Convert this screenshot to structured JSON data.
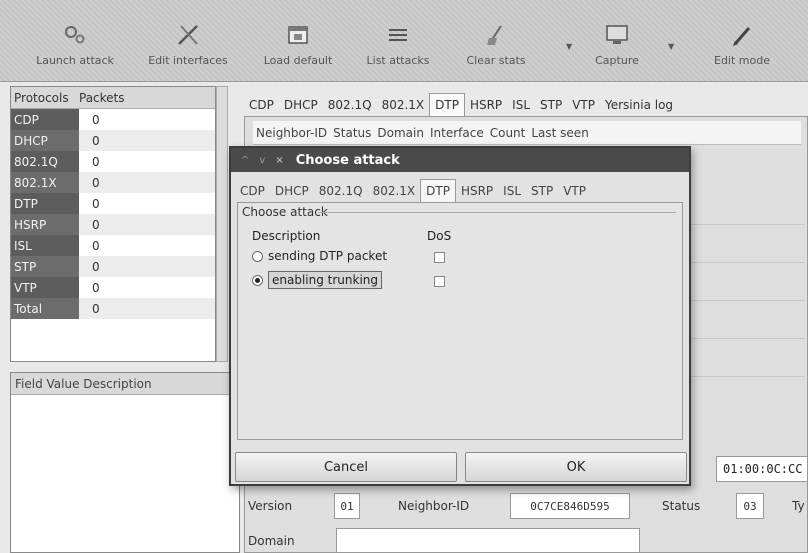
{
  "toolbar": {
    "buttons": [
      {
        "label": "Launch attack",
        "icon": "gears-icon"
      },
      {
        "label": "Edit interfaces",
        "icon": "tools-icon"
      },
      {
        "label": "Load default",
        "icon": "window-icon"
      },
      {
        "label": "List attacks",
        "icon": "list-icon"
      },
      {
        "label": "Clear stats",
        "icon": "broom-icon"
      },
      {
        "label": "Capture",
        "icon": "monitor-icon"
      },
      {
        "label": "Edit mode",
        "icon": "pen-icon"
      }
    ]
  },
  "protocols": {
    "header_protocols": "Protocols",
    "header_packets": "Packets",
    "rows": [
      {
        "name": "CDP",
        "count": "0"
      },
      {
        "name": "DHCP",
        "count": "0"
      },
      {
        "name": "802.1Q",
        "count": "0"
      },
      {
        "name": "802.1X",
        "count": "0"
      },
      {
        "name": "DTP",
        "count": "0"
      },
      {
        "name": "HSRP",
        "count": "0"
      },
      {
        "name": "ISL",
        "count": "0"
      },
      {
        "name": "STP",
        "count": "0"
      },
      {
        "name": "VTP",
        "count": "0"
      },
      {
        "name": "Total",
        "count": "0"
      }
    ]
  },
  "fields_panel": {
    "header": "Field  Value  Description"
  },
  "main_tabs": [
    "CDP",
    "DHCP",
    "802.1Q",
    "802.1X",
    "DTP",
    "HSRP",
    "ISL",
    "STP",
    "VTP",
    "Yersinia log"
  ],
  "main_active_tab": "DTP",
  "neighbor_columns": [
    "Neighbor-ID",
    "Status",
    "Domain",
    "Interface",
    "Count",
    "Last seen"
  ],
  "dialog": {
    "title": "Choose attack",
    "ctrl_min": "^",
    "ctrl_max": "v",
    "ctrl_close": "×",
    "tabs": [
      "CDP",
      "DHCP",
      "802.1Q",
      "802.1X",
      "DTP",
      "HSRP",
      "ISL",
      "STP",
      "VTP"
    ],
    "active_tab": "DTP",
    "frame_title": "Choose attack",
    "col_description": "Description",
    "col_dos": "DoS",
    "attacks": [
      {
        "label": "sending DTP packet",
        "selected": false,
        "dos": false
      },
      {
        "label": "enabling trunking",
        "selected": true,
        "dos": false
      }
    ],
    "cancel_label": "Cancel",
    "ok_label": "OK"
  },
  "detail": {
    "mac_value": "01:00:0C:CC",
    "version_label": "Version",
    "version_value": "01",
    "neighbor_label": "Neighbor-ID",
    "neighbor_value": "0C7CE846D595",
    "status_label": "Status",
    "status_value": "03",
    "type_label": "Ty",
    "domain_label": "Domain"
  }
}
